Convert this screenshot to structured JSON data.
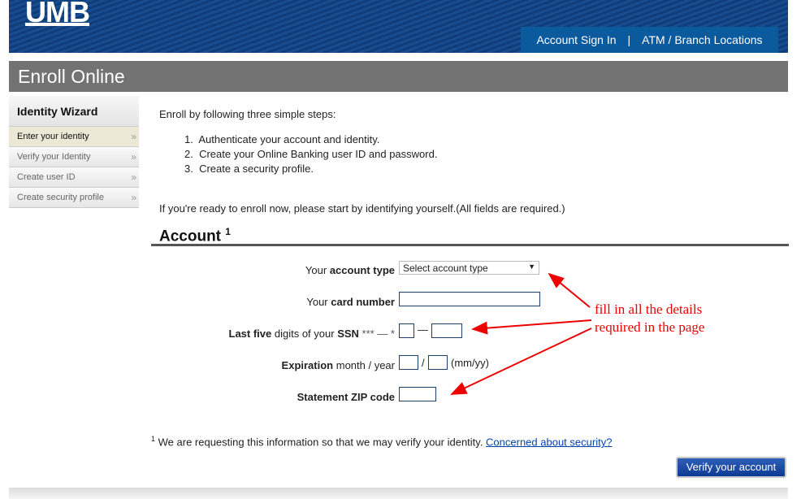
{
  "header": {
    "logo": "UMB",
    "nav": [
      "Account Sign In",
      "ATM / Branch Locations"
    ],
    "separator": "|"
  },
  "title": "Enroll Online",
  "sidebar": {
    "heading": "Identity Wizard",
    "items": [
      {
        "label": "Enter your identity",
        "active": true
      },
      {
        "label": "Verify your Identity"
      },
      {
        "label": "Create user ID"
      },
      {
        "label": "Create security profile"
      }
    ]
  },
  "intro": "Enroll by following three simple steps:",
  "steps": [
    "1.  Authenticate your account and identity.",
    "2.  Create your Online Banking user ID and password.",
    "3.  Create a security profile."
  ],
  "ready": "If you're ready to enroll now, please start by identifying yourself.(All fields are required.)",
  "section": {
    "title": "Account",
    "sup": "1"
  },
  "form": {
    "account_type": {
      "pre": "Your ",
      "bold": "account type",
      "value": "Select account type"
    },
    "card": {
      "pre": "Your ",
      "bold": "card number",
      "value": ""
    },
    "ssn": {
      "bold1": "Last five",
      "mid": " digits of your ",
      "bold2": "SSN",
      "mask": " *** — *",
      "dash": "—"
    },
    "exp": {
      "bold": "Expiration",
      "post": " month / year",
      "slash": "/",
      "hint": "(mm/yy)"
    },
    "zip": {
      "bold": "Statement ZIP code"
    }
  },
  "footnote": {
    "sup": "1",
    "text": " We are requesting this information so that we may verify your identity. ",
    "link": "Concerned about security?"
  },
  "verify_button": "Verify your account",
  "annotation": [
    "fill in all the details",
    "required in the page"
  ],
  "colors": {
    "banner": "#174c8e",
    "nav": "#0b5a9e",
    "titlebar": "#737373",
    "annotation": "#ee0000",
    "button": "#0d3a94"
  }
}
